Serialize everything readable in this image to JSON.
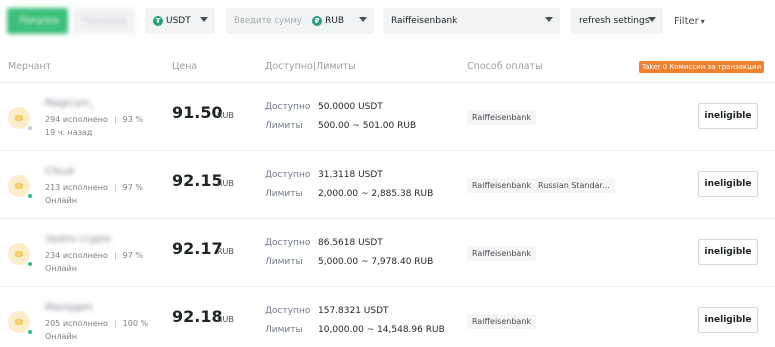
{
  "toolbar": {
    "buy_tab": "Покупка",
    "sell_tab": "Продажа",
    "asset": "USDT",
    "asset_icon": "usdt-coin-icon",
    "amount_placeholder": "Введите сумму",
    "fiat": "RUB",
    "fiat_icon": "rub-coin-icon",
    "payment_method": "Raiffeisenbank",
    "refresh": "refresh settings",
    "filter": "Filter",
    "accent": "#3cbf78"
  },
  "table": {
    "headers": {
      "merchant": "Мерчант",
      "price": "Цена",
      "available_limits": "Доступно|Лимиты",
      "payment": "Способ оплаты"
    },
    "taker_badge": "Taker 0 Комиссии за транзакции",
    "available_label": "Доступно",
    "limits_label": "Лимиты",
    "currency": "RUB",
    "action_label": "ineligible",
    "rows": [
      {
        "name": "Magicoin_",
        "orders": "294 исполнено",
        "completion": "93 %",
        "status": "19 ч. назад",
        "online": false,
        "price": "91.50",
        "available": "50.0000 USDT",
        "limits": "500.00 ~ 501.00 RUB",
        "payments": [
          "Raiffeisenbank"
        ]
      },
      {
        "name": "Cloud",
        "orders": "213 исполнено",
        "completion": "97 %",
        "status": "Онлайн",
        "online": true,
        "price": "92.15",
        "available": "31.3118 USDT",
        "limits": "2,000.00 ~ 2,885.38 RUB",
        "payments": [
          "Raiffeisenbank",
          "Russian Standar..."
        ]
      },
      {
        "name": "Vadim crypto",
        "orders": "234 исполнено",
        "completion": "97 %",
        "status": "Онлайн",
        "online": true,
        "price": "92.17",
        "available": "86.5618 USDT",
        "limits": "5,000.00 ~ 7,978.40 RUB",
        "payments": [
          "Raiffeisenbank"
        ]
      },
      {
        "name": "Maxiygen",
        "orders": "205 исполнено",
        "completion": "100 %",
        "status": "Онлайн",
        "online": true,
        "price": "92.18",
        "available": "157.8321 USDT",
        "limits": "10,000.00 ~ 14,548.96 RUB",
        "payments": [
          "Raiffeisenbank"
        ]
      }
    ]
  }
}
